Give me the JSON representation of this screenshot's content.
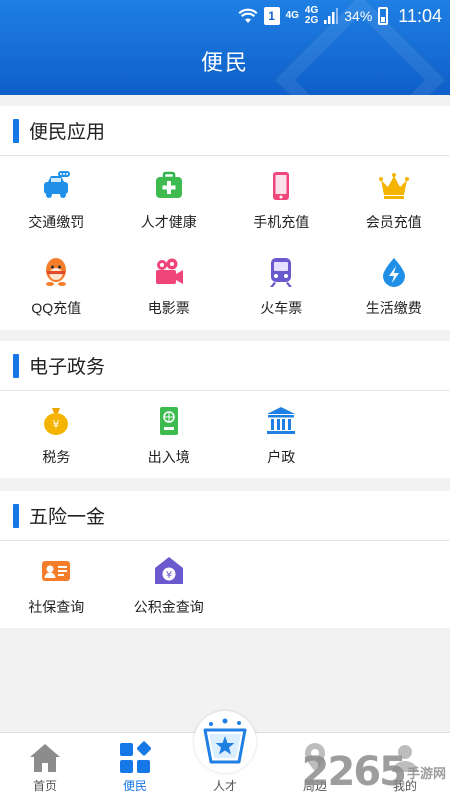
{
  "status_bar": {
    "sim": "1",
    "network_top": "4G",
    "network_mid": "4G",
    "network_bot": "2G",
    "battery": "34%",
    "time": "11:04"
  },
  "header": {
    "title": "便民"
  },
  "sections": [
    {
      "title": "便民应用",
      "items": [
        {
          "label": "交通缴罚",
          "icon": "car-icon"
        },
        {
          "label": "人才健康",
          "icon": "medical-kit-icon"
        },
        {
          "label": "手机充值",
          "icon": "phone-icon"
        },
        {
          "label": "会员充值",
          "icon": "crown-icon"
        },
        {
          "label": "QQ充值",
          "icon": "qq-penguin-icon"
        },
        {
          "label": "电影票",
          "icon": "movie-camera-icon"
        },
        {
          "label": "火车票",
          "icon": "train-icon"
        },
        {
          "label": "生活缴费",
          "icon": "water-drop-bolt-icon"
        }
      ]
    },
    {
      "title": "电子政务",
      "items": [
        {
          "label": "税务",
          "icon": "money-bag-icon"
        },
        {
          "label": "出入境",
          "icon": "passport-icon"
        },
        {
          "label": "户政",
          "icon": "government-building-icon"
        }
      ]
    },
    {
      "title": "五险一金",
      "items": [
        {
          "label": "社保查询",
          "icon": "id-card-icon"
        },
        {
          "label": "公积金查询",
          "icon": "house-yuan-icon"
        }
      ]
    }
  ],
  "tabbar": {
    "items": [
      {
        "label": "首页",
        "icon": "home-icon"
      },
      {
        "label": "便民",
        "icon": "apps-grid-icon"
      },
      {
        "label": "人才",
        "icon": "talent-center-icon"
      },
      {
        "label": "周边",
        "icon": "nearby-icon"
      },
      {
        "label": "我的",
        "icon": "profile-icon"
      }
    ],
    "active": "便民"
  },
  "watermark": {
    "number": "2265",
    "site": "手游网"
  },
  "colors": {
    "header_blue": "#1566cf",
    "accent_blue": "#1677e6",
    "page_bg": "#f2f2f2"
  }
}
